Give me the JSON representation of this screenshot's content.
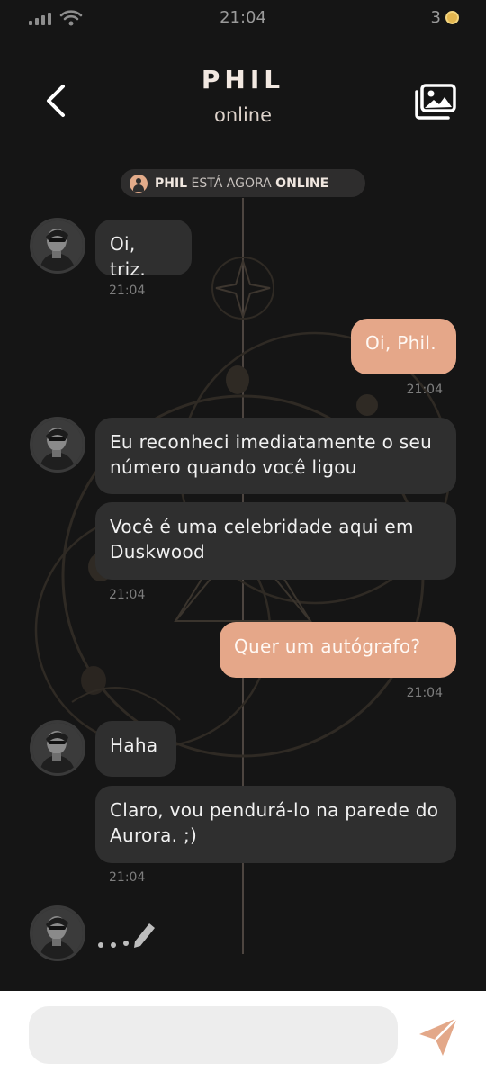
{
  "status_bar": {
    "time": "21:04",
    "coins": "3"
  },
  "header": {
    "name": "PHIL",
    "status": "online"
  },
  "notice": {
    "name": "PHIL",
    "middle": " ESTÁ AGORA ",
    "state": "ONLINE"
  },
  "messages": [
    {
      "text": "Oi, triz.",
      "time": "21:04"
    },
    {
      "text": "Oi, Phil.",
      "time": "21:04"
    },
    {
      "text": "Eu reconheci imediatamente o seu número quando você ligou"
    },
    {
      "text": "Você é uma celebridade aqui em Duskwood",
      "time": "21:04"
    },
    {
      "text": "Quer um autógrafo?",
      "time": "21:04"
    },
    {
      "text": "Haha"
    },
    {
      "text": "Claro, vou pendurá-lo na parede do Aurora. ;)",
      "time": "21:04"
    }
  ],
  "input": {
    "value": "",
    "placeholder": ""
  },
  "colors": {
    "incoming_bubble": "#2f2f2f",
    "outgoing_bubble": "#e5a789",
    "accent": "#e3ab8a",
    "background": "#151515"
  },
  "icons": [
    "signal-icon",
    "wifi-icon",
    "coin-icon",
    "back-arrow-icon",
    "gallery-icon",
    "user-icon",
    "typing-pencil-icon",
    "send-icon"
  ]
}
